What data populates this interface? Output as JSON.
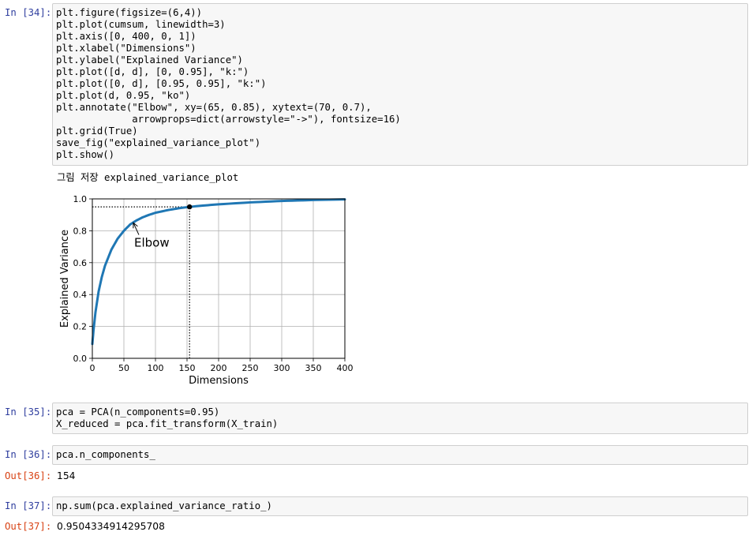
{
  "cells": [
    {
      "prompt": "In [34]:",
      "lines": [
        "plt.figure(figsize=(6,4))",
        "plt.plot(cumsum, linewidth=3)",
        "plt.axis([0, 400, 0, 1])",
        "plt.xlabel(\"Dimensions\")",
        "plt.ylabel(\"Explained Variance\")",
        "plt.plot([d, d], [0, 0.95], \"k:\")",
        "plt.plot([0, d], [0.95, 0.95], \"k:\")",
        "plt.plot(d, 0.95, \"ko\")",
        "plt.annotate(\"Elbow\", xy=(65, 0.85), xytext=(70, 0.7),",
        "             arrowprops=dict(arrowstyle=\"->\"), fontsize=16)",
        "plt.grid(True)",
        "save_fig(\"explained_variance_plot\")",
        "plt.show()"
      ],
      "output_text": "그림 저장 explained_variance_plot"
    },
    {
      "prompt": "In [35]:",
      "lines": [
        "pca = PCA(n_components=0.95)",
        "X_reduced = pca.fit_transform(X_train)"
      ]
    },
    {
      "prompt": "In [36]:",
      "lines": [
        "pca.n_components_"
      ],
      "out_prompt": "Out[36]:",
      "out_value": "154"
    },
    {
      "prompt": "In [37]:",
      "lines": [
        "np.sum(pca.explained_variance_ratio_)"
      ],
      "out_prompt": "Out[37]:",
      "out_value": "0.9504334914295708"
    }
  ],
  "chart_data": {
    "type": "line",
    "xlabel": "Dimensions",
    "ylabel": "Explained Variance",
    "xlim": [
      0,
      400
    ],
    "ylim": [
      0,
      1
    ],
    "xticks": [
      0,
      50,
      100,
      150,
      200,
      250,
      300,
      350,
      400
    ],
    "yticks": [
      0.0,
      0.2,
      0.4,
      0.6,
      0.8,
      1.0
    ],
    "xtick_labels": [
      "0",
      "50",
      "100",
      "150",
      "200",
      "250",
      "300",
      "350",
      "400"
    ],
    "ytick_labels": [
      "0.0",
      "0.2",
      "0.4",
      "0.6",
      "0.8",
      "1.0"
    ],
    "grid": true,
    "series": [
      {
        "color": "#1f77b4",
        "x": [
          0,
          2,
          5,
          10,
          15,
          20,
          30,
          40,
          50,
          60,
          70,
          80,
          90,
          100,
          120,
          140,
          154,
          175,
          200,
          250,
          300,
          350,
          400
        ],
        "y": [
          0.09,
          0.18,
          0.29,
          0.42,
          0.51,
          0.58,
          0.68,
          0.75,
          0.8,
          0.84,
          0.865,
          0.885,
          0.9,
          0.913,
          0.93,
          0.943,
          0.95,
          0.958,
          0.966,
          0.978,
          0.987,
          0.993,
          0.997
        ]
      }
    ],
    "dotted_lines": [
      {
        "x": [
          154,
          154
        ],
        "y": [
          0,
          0.95
        ],
        "color": "#000000"
      },
      {
        "x": [
          0,
          154
        ],
        "y": [
          0.95,
          0.95
        ],
        "color": "#000000"
      }
    ],
    "marker": {
      "x": 154,
      "y": 0.95,
      "color": "#000000"
    },
    "annotation": {
      "text": "Elbow",
      "xy": [
        65,
        0.85
      ],
      "xytext": [
        70,
        0.7
      ]
    }
  }
}
